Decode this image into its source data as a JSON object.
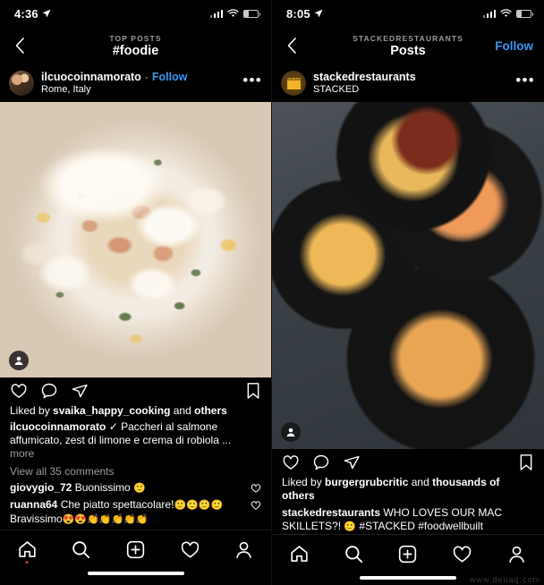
{
  "left": {
    "status": {
      "time": "4:36",
      "location_icon": "location-arrow-icon",
      "signal_icon": "signal-bars-icon",
      "wifi_icon": "wifi-icon",
      "battery_icon": "battery-low-icon"
    },
    "nav": {
      "back_icon": "chevron-left-icon",
      "kicker": "TOP POSTS",
      "title": "#foodie"
    },
    "post_header": {
      "avatar": "user-avatar",
      "username": "ilcuocoinnamorato",
      "separator": "·",
      "follow_label": "Follow",
      "subtitle": "Rome, Italy",
      "more_icon": "more-options-icon"
    },
    "media": {
      "tag_badge_icon": "tagged-users-icon",
      "alt": "paccheri pasta with salmon on white plate"
    },
    "actions": {
      "like_icon": "heart-icon",
      "comment_icon": "comment-icon",
      "share_icon": "share-paper-plane-icon",
      "save_icon": "bookmark-icon"
    },
    "likes": {
      "prefix": "Liked by ",
      "user": "svaika_happy_cooking",
      "middle": " and ",
      "suffix": "others"
    },
    "caption": {
      "username": "ilcuocoinnamorato",
      "verified_icon": "check-mark-icon",
      "text": " Paccheri al salmone affumicato, zest di limone e crema di robiola ...",
      "more_label": "more"
    },
    "view_all": "View all 35 comments",
    "comments": [
      {
        "user": "giovygio_72",
        "text": " Buonissimo ",
        "emoji": "🙂",
        "like_icon": "heart-outline-icon"
      },
      {
        "user": "ruanna64",
        "text": " Che piatto spettacolare!",
        "emoji": "🙂🙂🙂🙂",
        "text2": "Bravissimo",
        "emoji2": "😍😍👏👏👏👏👏",
        "like_icon": "heart-outline-icon"
      }
    ],
    "bottom_nav": [
      "home-icon",
      "search-icon",
      "add-post-icon",
      "activity-heart-icon",
      "profile-icon"
    ]
  },
  "right": {
    "status": {
      "time": "8:05",
      "location_icon": "location-arrow-icon",
      "signal_icon": "signal-bars-icon",
      "wifi_icon": "wifi-icon",
      "battery_icon": "battery-low-icon"
    },
    "nav": {
      "back_icon": "chevron-left-icon",
      "kicker": "STACKEDRESTAURANTS",
      "title": "Posts",
      "follow_label": "Follow"
    },
    "post_header": {
      "avatar": "brand-logo-avatar",
      "username": "stackedrestaurants",
      "subtitle": "STACKED",
      "more_icon": "more-options-icon"
    },
    "media": {
      "tag_badge_icon": "tagged-users-icon",
      "alt": "four cast iron skillets of mac and cheese with shrimp and brisket"
    },
    "actions": {
      "like_icon": "heart-icon",
      "comment_icon": "comment-icon",
      "share_icon": "share-paper-plane-icon",
      "save_icon": "bookmark-icon"
    },
    "likes": {
      "prefix": "Liked by ",
      "user": "burgergrubcritic",
      "middle": " and ",
      "suffix": "thousands of others"
    },
    "caption": {
      "username": "stackedrestaurants",
      "text": " WHO LOVES OUR MAC SKILLETS?! ",
      "emoji": "🙂",
      "hashtags": " #STACKED #foodwellbuilt"
    },
    "bottom_nav": [
      "home-icon",
      "search-icon",
      "add-post-icon",
      "activity-heart-icon",
      "profile-icon"
    ],
    "watermark": "www.deuaq.com"
  },
  "colors": {
    "accent_blue": "#3897f0",
    "background": "#000000",
    "muted_text": "#9a9a9a",
    "notification_dot": "#c03a2b"
  }
}
